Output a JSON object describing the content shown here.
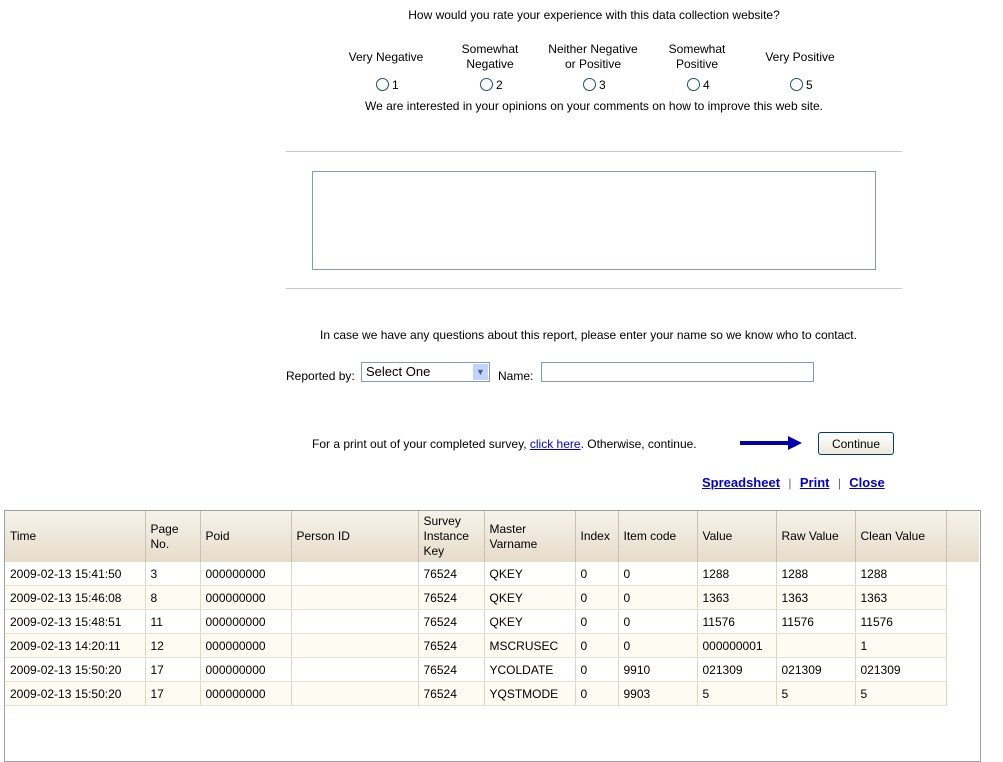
{
  "survey": {
    "question": "How would you rate your experience with this data collection website?",
    "options": [
      {
        "label": "Very Negative",
        "value": "1"
      },
      {
        "label": "Somewhat Negative",
        "value": "2"
      },
      {
        "label": "Neither Negative or Positive",
        "value": "3"
      },
      {
        "label": "Somewhat Positive",
        "value": "4"
      },
      {
        "label": "Very Positive",
        "value": "5"
      }
    ],
    "comment_prompt": "We are interested in your opinions on your comments on how to improve this web site.",
    "comment_value": "",
    "contact_prompt": "In case we have any questions about this report, please enter your name so we know who to contact.",
    "reported_by_label": "Reported by:",
    "reported_by_value": "Select One",
    "name_label": "Name:",
    "name_value": "",
    "print_text_before": "For a print out of your completed survey, ",
    "print_link": "click here",
    "print_text_after": ". Otherwise, continue.",
    "continue_label": "Continue"
  },
  "links": {
    "spreadsheet": "Spreadsheet",
    "print": "Print",
    "close": "Close",
    "sep": "|"
  },
  "table": {
    "headers": [
      "Time",
      "Page No.",
      "Poid",
      "Person ID",
      "Survey Instance Key",
      "Master Varname",
      "Index",
      "Item code",
      "Value",
      "Raw Value",
      "Clean Value"
    ],
    "rows": [
      [
        "2009-02-13 15:41:50",
        "3",
        "000000000",
        "",
        "76524",
        "QKEY",
        "0",
        "0",
        "1288",
        "1288",
        "1288"
      ],
      [
        "2009-02-13 15:46:08",
        "8",
        "000000000",
        "",
        "76524",
        "QKEY",
        "0",
        "0",
        "1363",
        "1363",
        "1363"
      ],
      [
        "2009-02-13 15:48:51",
        "11",
        "000000000",
        "",
        "76524",
        "QKEY",
        "0",
        "0",
        "11576",
        "11576",
        "11576"
      ],
      [
        "2009-02-13 14:20:11",
        "12",
        "000000000",
        "",
        "76524",
        "MSCRUSEC",
        "0",
        "0",
        "000000001",
        "",
        "1"
      ],
      [
        "2009-02-13 15:50:20",
        "17",
        "000000000",
        "",
        "76524",
        "YCOLDATE",
        "0",
        "9910",
        "021309",
        "021309",
        "021309"
      ],
      [
        "2009-02-13 15:50:20",
        "17",
        "000000000",
        "",
        "76524",
        "YQSTMODE",
        "0",
        "9903",
        "5",
        "5",
        "5"
      ]
    ]
  }
}
